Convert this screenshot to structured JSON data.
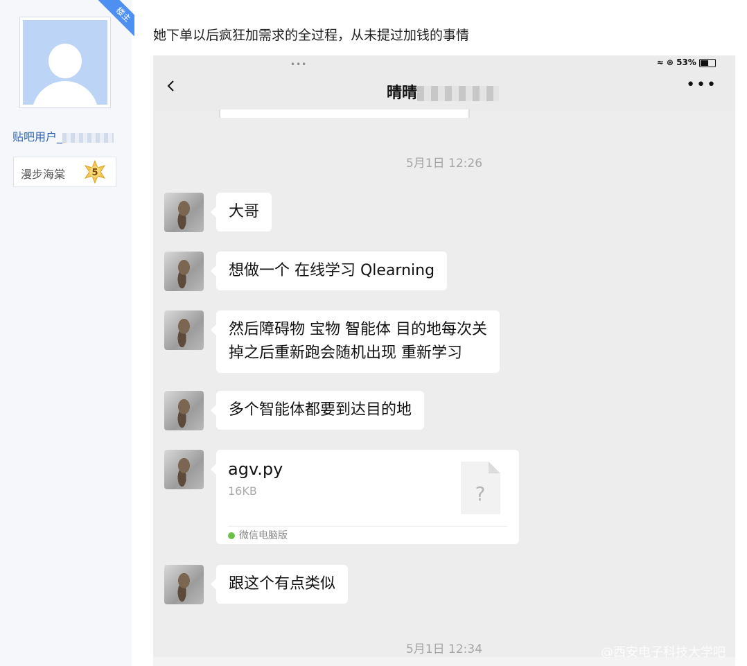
{
  "author": {
    "badge": "楼主",
    "username": "贴吧用户_",
    "level_name": "漫步海棠",
    "level_number": "5"
  },
  "post": {
    "text": "她下单以后疯狂加需求的全过程，从未提过加钱的事情"
  },
  "screenshot": {
    "status_bar": {
      "battery": "53%"
    },
    "nav": {
      "back_icon": "chevron-left-icon",
      "title": "晴晴",
      "more_icon": "more-icon"
    },
    "timestamps": [
      "5月1日 12:26",
      "5月1日 12:34"
    ],
    "messages": [
      {
        "text": "大哥"
      },
      {
        "text": "想做一个 在线学习 Qlearning"
      },
      {
        "line1": "然后障碍物 宝物 智能体 目的地每次关",
        "line2": "掉之后重新跑会随机出现 重新学习"
      },
      {
        "text": "多个智能体都要到达目的地"
      },
      {
        "text": "跟这个有点类似"
      }
    ],
    "file": {
      "name": "agv.py",
      "size": "16KB",
      "icon_glyph": "?",
      "source": "微信电脑版"
    },
    "watermark": "@西安电子科技大学吧"
  }
}
